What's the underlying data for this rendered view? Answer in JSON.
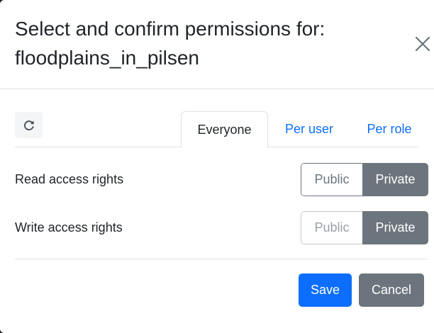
{
  "dialog": {
    "title_line1": "Select and confirm permissions for:",
    "title_line2": "floodplains_in_pilsen",
    "close_icon": "close-icon"
  },
  "toolbar": {
    "refresh_icon": "refresh-icon"
  },
  "tabs": [
    {
      "label": "Everyone",
      "active": true
    },
    {
      "label": "Per user",
      "active": false
    },
    {
      "label": "Per role",
      "active": false
    }
  ],
  "permissions": {
    "read": {
      "label": "Read access rights",
      "public_label": "Public",
      "private_label": "Private",
      "selected": "Private"
    },
    "write": {
      "label": "Write access rights",
      "public_label": "Public",
      "private_label": "Private",
      "selected": "Private"
    }
  },
  "footer": {
    "save_label": "Save",
    "cancel_label": "Cancel"
  },
  "colors": {
    "primary": "#0d6efd",
    "secondary": "#6c757d",
    "text": "#212529",
    "border": "#dee2e6"
  }
}
